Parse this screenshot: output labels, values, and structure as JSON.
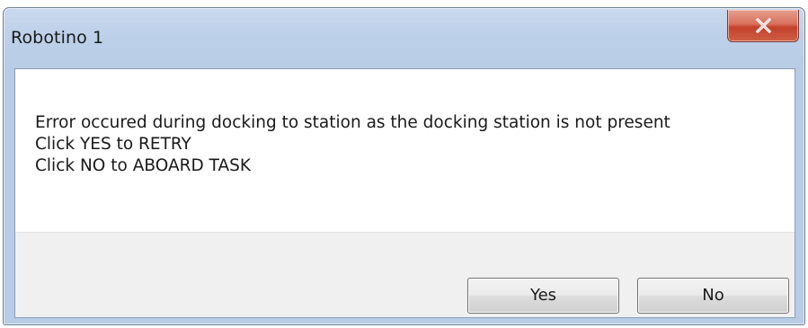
{
  "window": {
    "title": "Robotino 1",
    "close_icon": "close-x-icon"
  },
  "message": {
    "lines": [
      "Error occured during docking to station as the docking station is not present",
      "Click YES to RETRY",
      "Click NO to ABOARD TASK"
    ]
  },
  "buttons": {
    "yes_label": "Yes",
    "no_label": "No"
  },
  "colors": {
    "titlebar": "#bdd0ea",
    "close_button": "#c4412b",
    "button_panel": "#f0f0f0"
  }
}
